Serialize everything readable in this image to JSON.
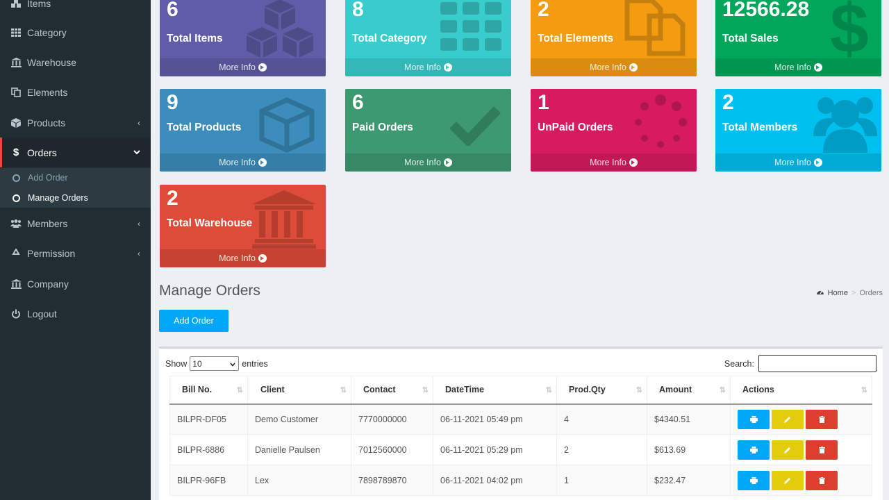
{
  "sidebar": {
    "items": [
      {
        "label": "Items",
        "icon": "cubes-icon"
      },
      {
        "label": "Category",
        "icon": "grid-icon"
      },
      {
        "label": "Warehouse",
        "icon": "bank-icon"
      },
      {
        "label": "Elements",
        "icon": "copy-icon"
      },
      {
        "label": "Products",
        "icon": "cube-icon"
      },
      {
        "label": "Orders",
        "icon": "dollar-icon"
      },
      {
        "label": "Members",
        "icon": "users-icon"
      },
      {
        "label": "Permission",
        "icon": "recycle-icon"
      },
      {
        "label": "Company",
        "icon": "bank-icon"
      },
      {
        "label": "Logout",
        "icon": "power-icon"
      }
    ],
    "orders_submenu": [
      "Add Order",
      "Manage Orders"
    ]
  },
  "stats": [
    {
      "value": "6",
      "label": "Total Items",
      "color": "#605ca8",
      "icon": "cubes-icon"
    },
    {
      "value": "8",
      "label": "Total Category",
      "color": "#39cccc",
      "icon": "grid-icon"
    },
    {
      "value": "2",
      "label": "Total Elements",
      "color": "#f39c12",
      "icon": "copy-icon"
    },
    {
      "value": "12566.28",
      "label": "Total Sales",
      "color": "#00a65a",
      "icon": "dollar-icon"
    },
    {
      "value": "9",
      "label": "Total Products",
      "color": "#3c8dbc",
      "icon": "cube-icon"
    },
    {
      "value": "6",
      "label": "Paid Orders",
      "color": "#3d9970",
      "icon": "check-icon"
    },
    {
      "value": "1",
      "label": "UnPaid Orders",
      "color": "#d81b60",
      "icon": "spinner-icon"
    },
    {
      "value": "2",
      "label": "Total Members",
      "color": "#00c0ef",
      "icon": "users-icon"
    },
    {
      "value": "2",
      "label": "Total Warehouse",
      "color": "#dd4b39",
      "icon": "bank-icon"
    }
  ],
  "more_info": "More Info",
  "page": {
    "title": "Manage Orders",
    "breadcrumb_home": "Home",
    "breadcrumb_current": "Orders",
    "add_order": "Add Order"
  },
  "table": {
    "show_label": "Show",
    "entries_value": "10",
    "entries_label": "entries",
    "search_label": "Search:",
    "columns": [
      "Bill No.",
      "Client",
      "Contact",
      "DateTime",
      "Prod.Qty",
      "Amount",
      "Actions"
    ],
    "rows": [
      {
        "bill": "BILPR-DF05",
        "client": "Demo Customer",
        "contact": "7770000000",
        "datetime": "06-11-2021 05:49 pm",
        "qty": "4",
        "amount": "$4340.51"
      },
      {
        "bill": "BILPR-6886",
        "client": "Danielle Paulsen",
        "contact": "7012560000",
        "datetime": "06-11-2021 05:29 pm",
        "qty": "2",
        "amount": "$613.69"
      },
      {
        "bill": "BILPR-96FB",
        "client": "Lex",
        "contact": "7898789870",
        "datetime": "06-11-2021 04:02 pm",
        "qty": "1",
        "amount": "$232.47"
      }
    ]
  }
}
